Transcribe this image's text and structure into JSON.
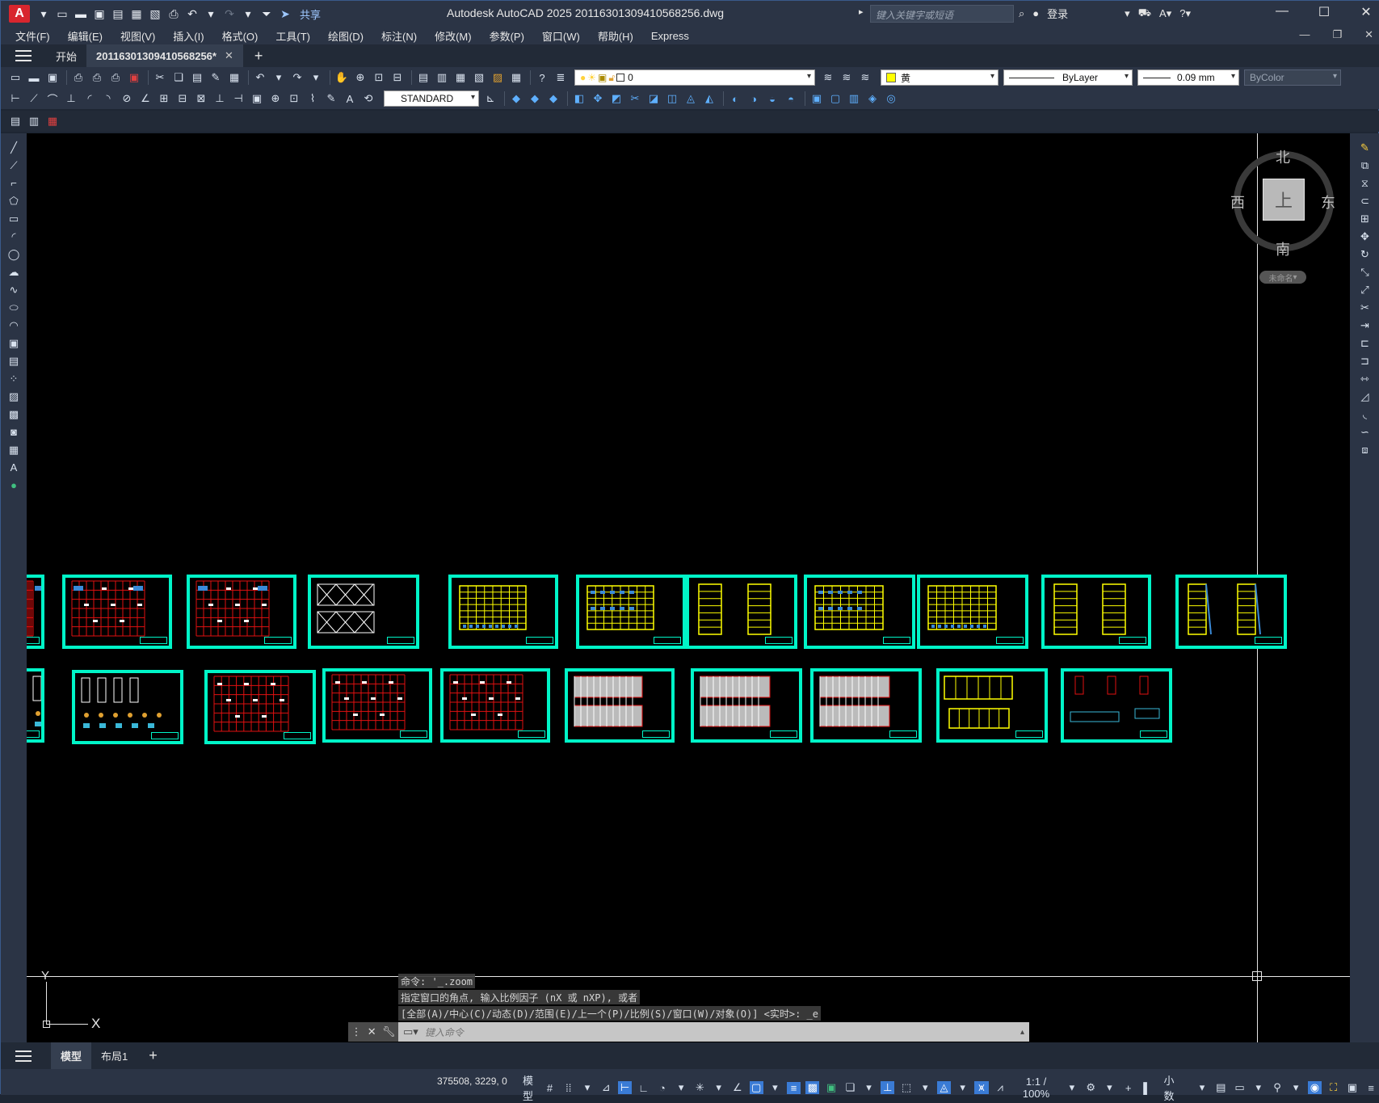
{
  "app": {
    "logo_letter": "A",
    "title": "Autodesk AutoCAD 2025    20116301309410568256.dwg",
    "search_placeholder": "键入关键字或短语",
    "login": "登录",
    "share": "共享"
  },
  "menu": [
    "文件(F)",
    "编辑(E)",
    "视图(V)",
    "插入(I)",
    "格式(O)",
    "工具(T)",
    "绘图(D)",
    "标注(N)",
    "修改(M)",
    "参数(P)",
    "窗口(W)",
    "帮助(H)",
    "Express"
  ],
  "tabs": {
    "start": "开始",
    "document": "20116301309410568256*"
  },
  "toolbar": {
    "layer_value": "0",
    "color_value": "黄",
    "linetype_value": "ByLayer",
    "lineweight_value": "0.09 mm",
    "plotstyle_value": "ByColor",
    "textstyle_value": "STANDARD"
  },
  "viewcube": {
    "north": "北",
    "south": "南",
    "east": "东",
    "west": "西",
    "face": "上",
    "wcs": "未命名"
  },
  "ucs": {
    "x": "X",
    "y": "Y"
  },
  "command": {
    "history": [
      "命令: '_.zoom",
      "指定窗口的角点, 输入比例因子 (nX 或 nXP), 或者",
      "[全部(A)/中心(C)/动态(D)/范围(E)/上一个(P)/比例(S)/窗口(W)/对象(O)] <实时>: _e"
    ],
    "placeholder": "键入命令"
  },
  "layout_tabs": [
    "模型",
    "布局1"
  ],
  "status": {
    "coords": "375508, 3229, 0",
    "mode": "模型",
    "scale": "1:1 / 100%",
    "units": "小数"
  },
  "colors": {
    "sheet_border": "#00f5c8",
    "red_grid": "#e01010",
    "yellow": "#ffff00"
  }
}
